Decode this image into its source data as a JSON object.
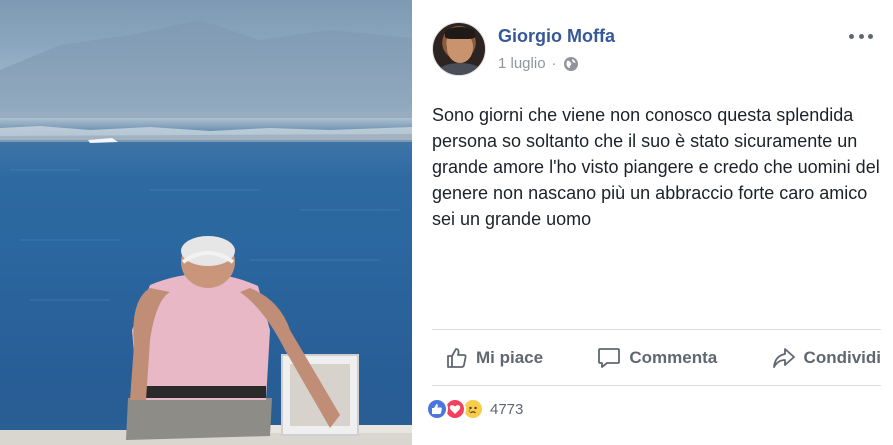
{
  "post": {
    "author": "Giorgio Moffa",
    "date": "1 luglio",
    "privacy_icon": "globe-icon",
    "menu_icon": "more-options-icon",
    "text": "Sono giorni che viene non conosco questa splendida persona so soltanto che il suo è stato sicuramente un grande amore l'ho visto piangere e credo che uomini del genere non nascano più un abbraccio forte caro amico sei un grande uomo"
  },
  "actions": [
    {
      "label": "Mi piace",
      "icon": "thumbs-up-icon"
    },
    {
      "label": "Commenta",
      "icon": "comment-icon"
    },
    {
      "label": "Condividi",
      "icon": "share-icon"
    }
  ],
  "reactions": {
    "types": [
      "like",
      "love",
      "sad"
    ],
    "count": "4773"
  },
  "colors": {
    "author_link": "#365899",
    "muted_text": "#90949c",
    "action_text": "#606770",
    "body_text": "#1d2129",
    "divider": "#dadde1",
    "like": "#4a77dc",
    "love": "#f2405f",
    "sad": "#f7cd4b"
  }
}
